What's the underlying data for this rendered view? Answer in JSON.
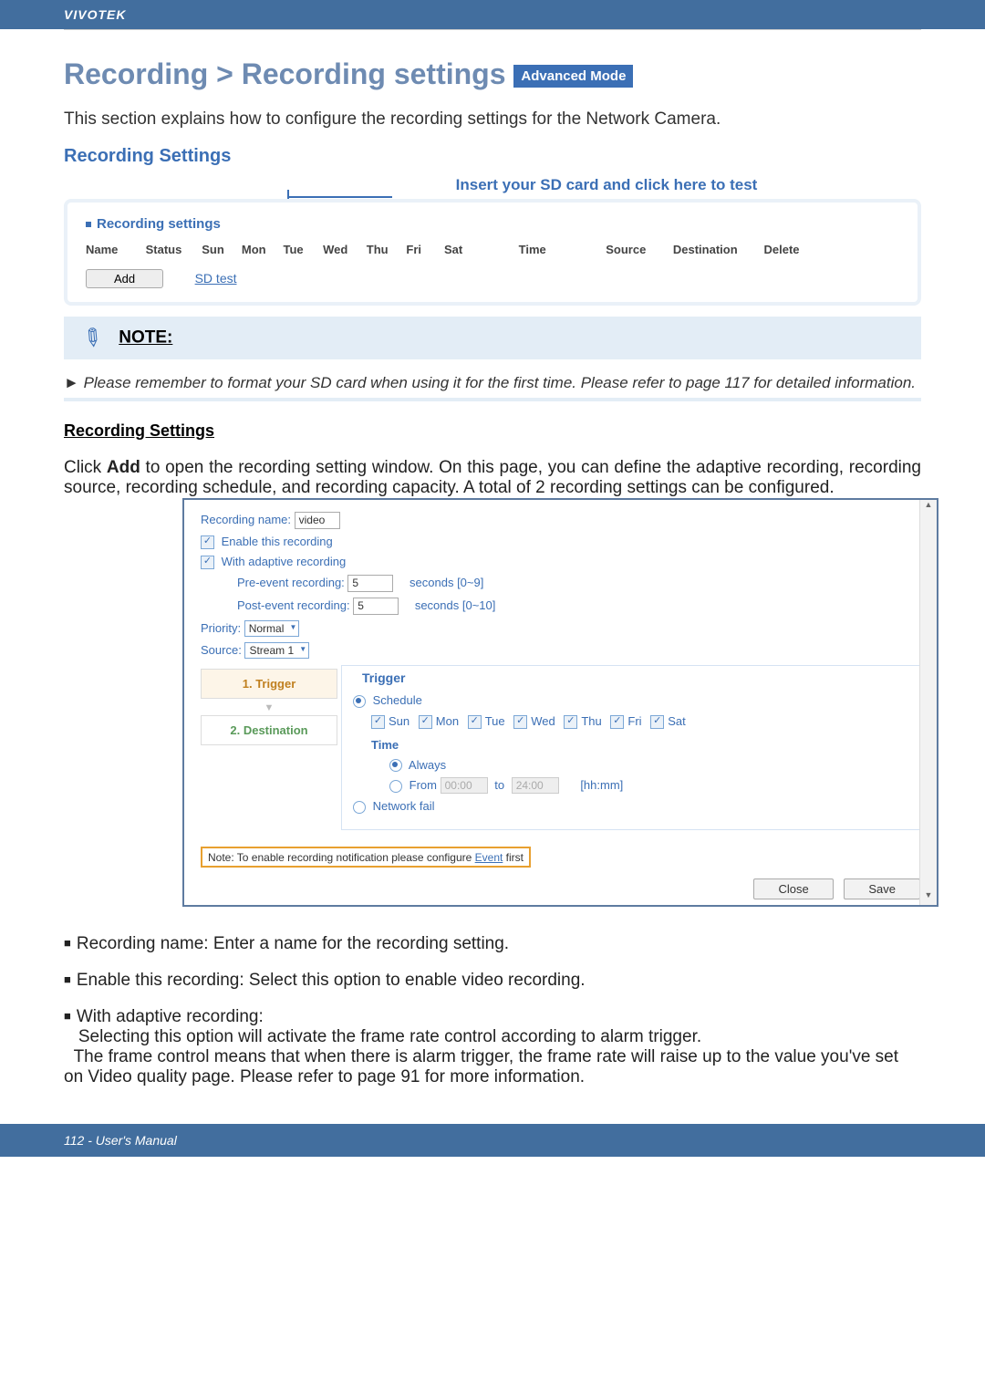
{
  "header": {
    "brand": "VIVOTEK"
  },
  "title": {
    "breadcrumb": "Recording > Recording settings",
    "badge": "Advanced Mode"
  },
  "intro": "This section explains how to configure the recording settings for the Network Camera.",
  "section_heading": "Recording Settings",
  "insert_label": "Insert your SD card and click here to test",
  "panel": {
    "title": "Recording settings",
    "cols": [
      "Name",
      "Status",
      "Sun",
      "Mon",
      "Tue",
      "Wed",
      "Thu",
      "Fri",
      "Sat",
      "Time",
      "Source",
      "Destination",
      "Delete"
    ],
    "add": "Add",
    "sd_test": "SD test"
  },
  "note": {
    "heading": "NOTE:",
    "arrow": "►",
    "text": "Please remember to format your SD card when using it for the first time. Please refer to page 117 for detailed information."
  },
  "rs_heading": "Recording Settings",
  "rs_para1": "Click ",
  "rs_add": "Add",
  "rs_para2": " to open the recording setting window. On this page, you can define the adaptive recording, recording source, recording schedule, and recording capacity. A total of 2 recording settings can be configured.",
  "dialog": {
    "recording_name_lbl": "Recording name:",
    "recording_name_val": "video",
    "enable_lbl": "Enable this recording",
    "adaptive_lbl": "With adaptive recording",
    "pre_lbl": "Pre-event recording:",
    "pre_val": "5",
    "pre_hint": "seconds [0~9]",
    "post_lbl": "Post-event recording:",
    "post_val": "5",
    "post_hint": "seconds [0~10]",
    "priority_lbl": "Priority:",
    "priority_val": "Normal",
    "source_lbl": "Source:",
    "source_val": "Stream 1",
    "wizard": {
      "step1": "1. Trigger",
      "step2": "2. Destination"
    },
    "trigger": {
      "title": "Trigger",
      "schedule": "Schedule",
      "days": [
        "Sun",
        "Mon",
        "Tue",
        "Wed",
        "Thu",
        "Fri",
        "Sat"
      ],
      "time_lbl": "Time",
      "always": "Always",
      "from": "From",
      "from_val": "00:00",
      "to": "to",
      "to_val": "24:00",
      "hhmm": "[hh:mm]",
      "network": "Network fail"
    },
    "note_prefix": "Note: To enable recording notification please configure ",
    "note_link": "Event",
    "note_suffix": " first",
    "close": "Close",
    "save": "Save"
  },
  "bullets": {
    "b1_lbl": "Recording name:",
    "b1_txt": " Enter a name for the recording setting.",
    "b2_lbl": "Enable this recording:",
    "b2_txt": " Select this option to enable video recording.",
    "b3_lbl": "With adaptive recording:",
    "b3_l1": "Selecting this option will activate the frame rate control according to alarm trigger.",
    "b3_l2": "The frame control means that when there is alarm trigger, the frame rate will raise up to the value you've set on Video quality page. Please refer to page 91 for more information."
  },
  "footer": "112 - User's Manual"
}
